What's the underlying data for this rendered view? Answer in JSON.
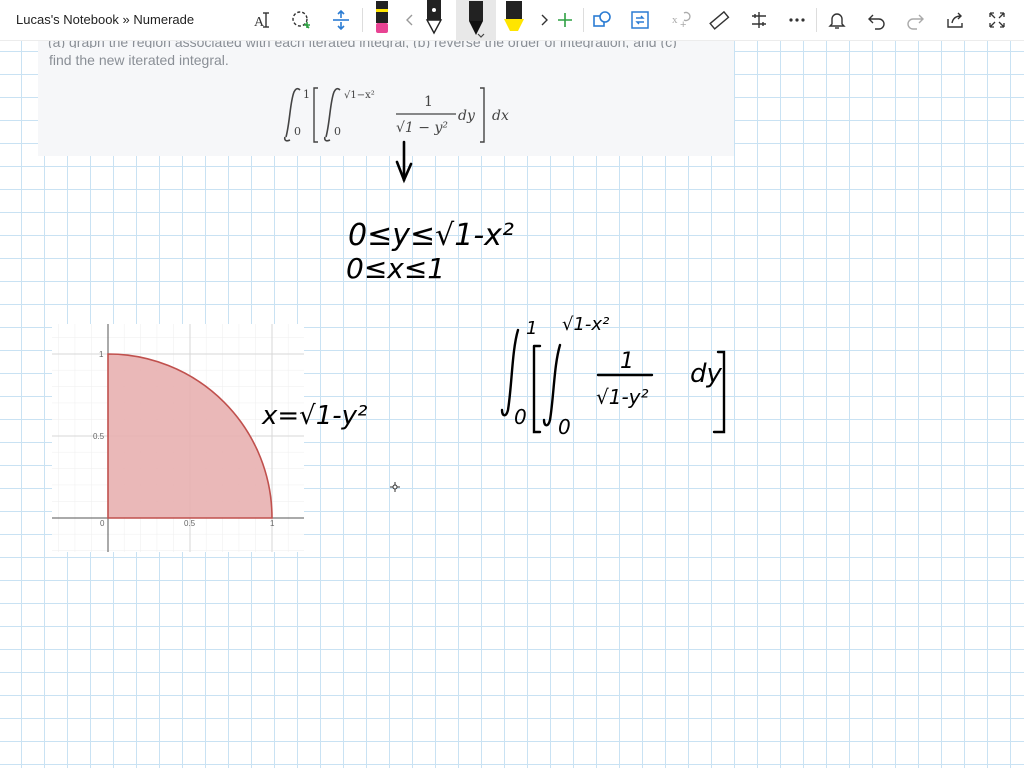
{
  "app": {
    "title": "Lucas's Notebook » Numerade"
  },
  "toolbar": {
    "tools": [
      "text-select-icon",
      "lasso-select-icon",
      "add-space-icon",
      "eraser-tool",
      "pen-white-tool",
      "pen-black-tool",
      "highlighter-yellow-tool",
      "add-pen-icon",
      "shapes-icon",
      "convert-icon",
      "math-icon",
      "ruler-icon",
      "view-options-icon",
      "more-icon",
      "bell-icon",
      "undo-icon",
      "redo-icon",
      "share-icon",
      "fullscreen-icon"
    ],
    "colors": {
      "accent": "#2b7cd3",
      "highlighter": "#ffe500",
      "eraser": "#e84393",
      "add_pen": "#2ea043"
    }
  },
  "problem": {
    "cut_line": "(a) graph the region associated with each iterated integral, (b) reverse the order of integration, and (c)",
    "text": "find the new iterated integral.",
    "formula": {
      "lower_outer": "0",
      "upper_outer": "1",
      "lower_inner": "0",
      "upper_inner": "√1−x²",
      "numerator": "1",
      "denominator": "√1 − y²",
      "inner_diff": "dy",
      "outer_diff": "dx"
    }
  },
  "handwriting": {
    "line1": "0≤y≤√1-x²",
    "line2": "0≤x≤1",
    "curve_label": "x=√1-y²",
    "integral_upper_outer": "1",
    "integral_lower_outer": "0",
    "integral_upper_inner": "√1-x²",
    "integral_lower_inner": "0",
    "integral_numerator": "1",
    "integral_denominator": "√1-y²",
    "integral_differential": "dy"
  },
  "graph": {
    "x_ticks": [
      "0",
      "0.5",
      "1"
    ],
    "y_ticks": [
      "1",
      "0.5"
    ],
    "region_color": "#e8b0b0",
    "edge_color": "#c0504d"
  }
}
